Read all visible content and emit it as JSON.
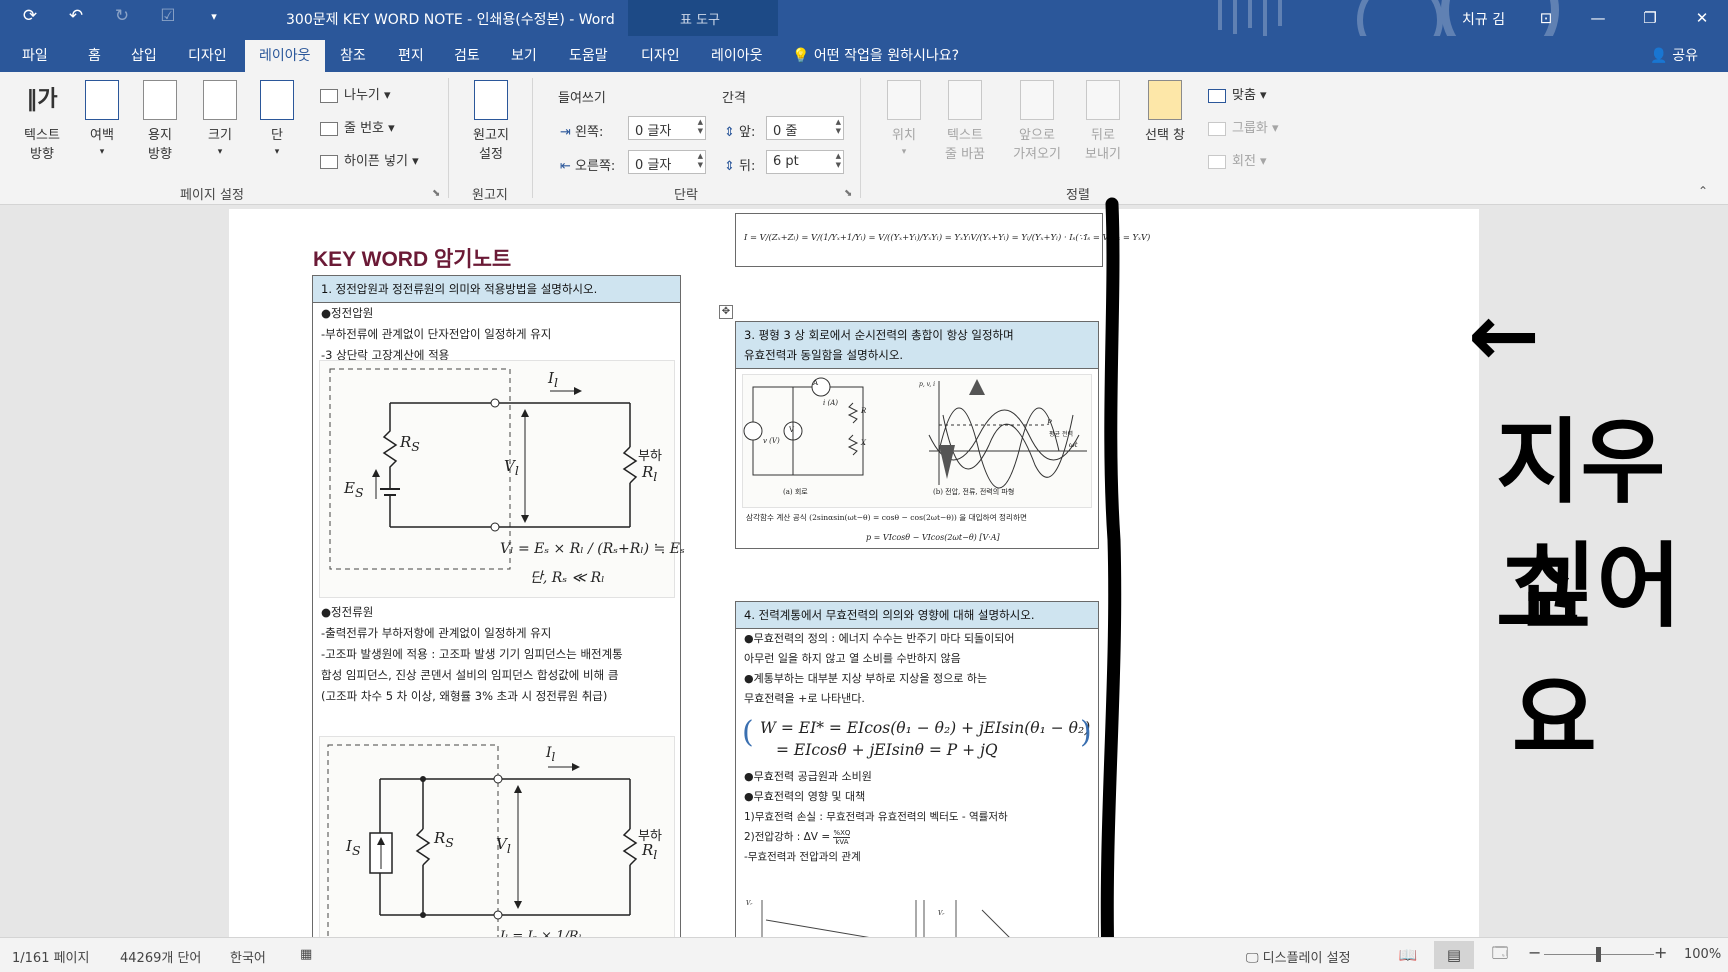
{
  "titlebar": {
    "document_title": "300문제 KEY WORD NOTE - 인쇄용(수정본) - Word",
    "context_label": "표 도구",
    "user": "치규 김",
    "icons": [
      "autosave-icon",
      "undo-icon",
      "redo-icon",
      "touch-mode-icon",
      "qat-customize-icon"
    ],
    "window_buttons": [
      "ribbon-display-icon",
      "minimize-icon",
      "restore-icon",
      "close-icon"
    ]
  },
  "tabs": [
    "파일",
    "홈",
    "삽입",
    "디자인",
    "레이아웃",
    "참조",
    "편지",
    "검토",
    "보기",
    "도움말",
    "디자인",
    "레이아웃"
  ],
  "active_tab": "레이아웃",
  "tell_me": "어떤 작업을 원하시나요?",
  "share": "공유",
  "ribbon": {
    "page_setup": {
      "label": "페이지 설정",
      "text_direction": "텍스트\n방향",
      "margins": "여백",
      "orientation": "용지\n방향",
      "size": "크기",
      "columns": "단",
      "breaks": "나누기",
      "line_numbers": "줄 번호",
      "hyphenation": "하이픈 넣기"
    },
    "manuscript": {
      "label": "원고지",
      "button": "원고지\n설정"
    },
    "paragraph": {
      "label": "단락",
      "indent_title": "들여쓰기",
      "spacing_title": "간격",
      "left_label": "왼쪽:",
      "left_value": "0 글자",
      "right_label": "오른쪽:",
      "right_value": "0 글자",
      "before_label": "앞:",
      "before_value": "0 줄",
      "after_label": "뒤:",
      "after_value": "6 pt"
    },
    "arrange": {
      "label": "정렬",
      "position": "위치",
      "wrap_text": "텍스트\n줄 바꿈",
      "bring_forward": "앞으로\n가져오기",
      "send_backward": "뒤로\n보내기",
      "selection_pane": "선택 창",
      "align": "맞춤",
      "group": "그룹화",
      "rotate": "회전"
    }
  },
  "document": {
    "heading": "KEY WORD 암기노트",
    "q1": {
      "title": "1. 정전압원과 정전류원의 의미와 적용방법을 설명하시오.",
      "cv_title": "●정전압원",
      "cv_lines": [
        "-부하전류에 관계없이 단자전압이 일정하게 유지",
        "-3 상단락 고장계산에 적용"
      ],
      "fig1_labels": {
        "il": "I",
        "il_sub": "l",
        "rs": "R",
        "rs_sub": "S",
        "es": "E",
        "es_sub": "S",
        "vl": "V",
        "vl_sub": "l",
        "load": "부하",
        "rl": "R",
        "rl_sub": "l"
      },
      "fig1_formula": "Vₗ = Eₛ × Rₗ / (Rₛ+Rₗ) ≒ Eₛ",
      "fig1_cond": "단, Rₛ ≪ Rₗ",
      "cc_title": "●정전류원",
      "cc_lines": [
        "-출력전류가 부하저항에 관계없이 일정하게 유지",
        "-고조파 발생원에 적용 : 고조파 발생 기기 임피던스는 배전계통",
        " 합성 임피던스, 진상 콘덴서 설비의 임피던스 합성값에 비해 큼",
        " (고조파 차수 5 차 이상, 왜형률 3% 초과 시 정전류원 취급)"
      ],
      "fig2_labels": {
        "il": "I",
        "il_sub": "l",
        "is": "I",
        "is_sub": "S",
        "rs": "R",
        "rs_sub": "S",
        "vl": "V",
        "vl_sub": "l",
        "load": "부하",
        "rl": "R",
        "rl_sub": "l"
      },
      "fig2_formula": "Iₗ = Iₛ × 1/Rₗ"
    },
    "top_formula": "I = V/(Zₓ+Zₗ) = V/(1/Yₓ+1/Yₗ) = V/((Yₓ+Yₗ)/YₓYₗ) = YₓYₗV/(Yₓ+Yₗ) = Yₗ/(Yₓ+Yₗ) · Iₛ(∵Iₛ = V/Zₓ = YₓV)",
    "q3": {
      "title_line1": "3. 평형 3 상 회로에서 순시전력의 총합이 항상 일정하며",
      "title_line2": "유효전력과 동일함을 설명하시오.",
      "fig_caption_a": "(a) 회로",
      "fig_caption_b": "(b) 전압, 전류, 전력의 파형",
      "fig_labels": {
        "a": "A",
        "i": "i (A)",
        "v": "V",
        "vt": "v (V)",
        "r": "R",
        "x": "X",
        "p": "P",
        "avg": "평균 전력",
        "wt": "ωt",
        "p_axis": "p, v, i"
      },
      "note": "삼각함수 계산 공식 (2sinαsin(ωt−θ) = cosθ − cos(2ωt−θ)) 을 대입하여 정리하면",
      "result": "p = VIcosθ − VIcos(2ωt−θ) [V·A]"
    },
    "q4": {
      "title": "4. 전력계통에서 무효전력의 의의와 영향에 대해 설명하시오.",
      "lines_a": [
        "●무효전력의 정의 : 에너지 수수는 반주기 마다 되돌이되어",
        " 아무런 일을 하지 않고 열 소비를 수반하지 않음",
        "●계통부하는 대부분 지상 부하로 지상을 정으로 하는",
        " 무효전력을 +로 나타낸다."
      ],
      "formula_line1": "W = EI* = EIcos(θ₁ − θ₂) + jEIsin(θ₁ − θ₂)",
      "formula_line2": "= EIcosθ + jEIsinθ = P + jQ",
      "lines_b": [
        "●무효전력 공급원과 소비원",
        "●무효전력의 영향 및 대책",
        " 1)무효전력 손실 : 무효전력과 유효전력의 벡터도 - 역률저하"
      ],
      "voltage_drop_label": " 2)전압강하 : ΔV = ",
      "voltage_drop_frac_num": "%XQ",
      "voltage_drop_frac_den": "kVA",
      "last_line": " -무효전력과 전압과의 관계",
      "graph_labels": [
        "Vᵣ",
        "Vᵣ"
      ]
    }
  },
  "annotation": {
    "arrow": "←",
    "line1": "지우고",
    "line2": "싶어요"
  },
  "statusbar": {
    "page": "1/161 페이지",
    "words": "44269개 단어",
    "language": "한국어",
    "display_settings": "디스플레이 설정",
    "zoom": "100%"
  },
  "colors": {
    "word_blue": "#2b579a",
    "ribbon_bg": "#f3f3f3",
    "heading": "#6b1a36",
    "question_header": "#cfe4f0"
  }
}
